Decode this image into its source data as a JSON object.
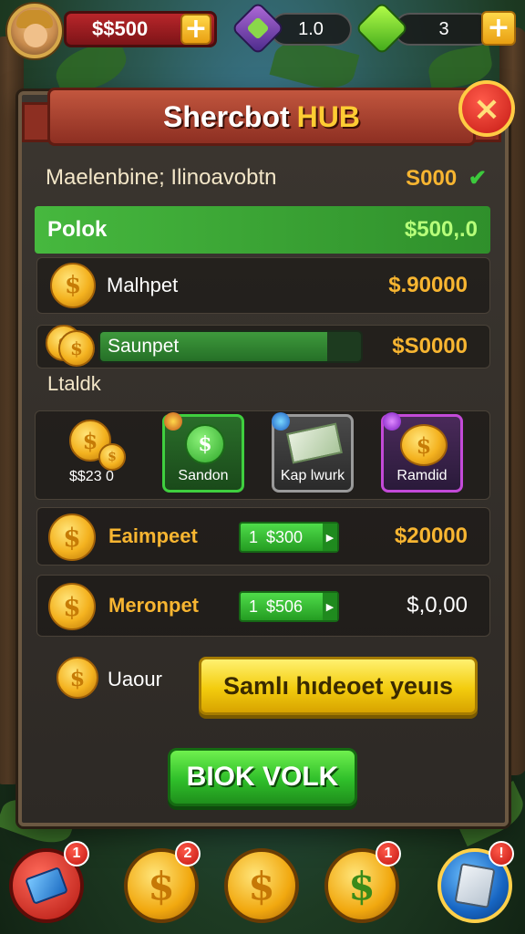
{
  "top_bar": {
    "money": "$$500",
    "plus": "+",
    "gem_value": "1.0",
    "cash_value": "3"
  },
  "panel": {
    "title": "Shercbot",
    "title_accent": "HUB",
    "close": "×",
    "header_label": "Maelenbine; Ilinoavobtn",
    "header_amount": "S000",
    "header_check": "✔",
    "pool_label": "Polok",
    "pool_amount": "$500,.0",
    "row1_label": "Malhpet",
    "row1_value": "$.90000",
    "progress_label": "Saunpet",
    "progress_fraction": 0.87,
    "progress_value": "$S0000",
    "section_label": "Ltaldk",
    "coin_stack_label": "$$23 0",
    "cards": [
      {
        "label": "Sandon",
        "style": "green"
      },
      {
        "label": "Kap lwurk",
        "style": "grey"
      },
      {
        "label": "Ramdid",
        "style": "purple"
      }
    ],
    "row2_label": "Eaimpeet",
    "row2_qty": "1",
    "row2_price": "$300",
    "row2_value": "$20000",
    "row3_label": "Meronpet",
    "row3_qty": "1",
    "row3_price": "$506",
    "row3_value": "$,0,00",
    "bottom_label": "Uaour",
    "yellow_button": "Samlı hıdeoet yeuıs",
    "green_button": "BIOK VOLK"
  },
  "bottom_nav": [
    {
      "badge": "1",
      "icon": "card-icon",
      "style": "red"
    },
    {
      "badge": "2",
      "icon": "coin-icon",
      "style": "gold"
    },
    {
      "badge": "",
      "icon": "coin-icon",
      "style": "gold"
    },
    {
      "badge": "1",
      "icon": "coin-icon",
      "style": "gold"
    },
    {
      "badge": "!",
      "icon": "cards-icon",
      "style": "blue"
    }
  ],
  "icons": {
    "dollar": "$",
    "arrow": "▶"
  },
  "colors": {
    "accent_gold": "#f7b531",
    "accent_green": "#3fcf3f",
    "accent_red": "#b8262a"
  }
}
